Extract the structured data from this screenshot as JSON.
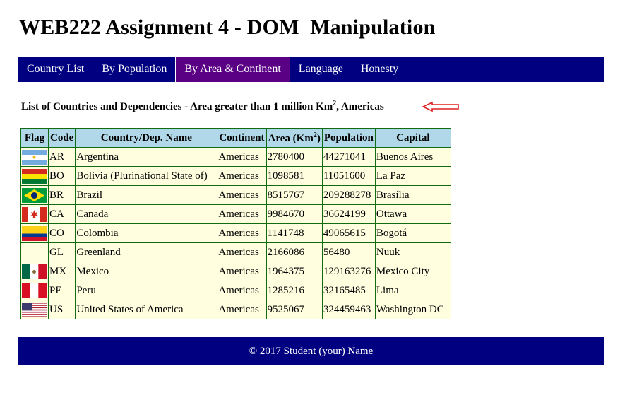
{
  "page": {
    "title": "WEB222 Assignment 4 - DOM  Manipulation"
  },
  "nav": {
    "items": [
      {
        "label": "Country List"
      },
      {
        "label": "By Population"
      },
      {
        "label": "By Area & Continent"
      },
      {
        "label": "Language"
      },
      {
        "label": "Honesty"
      }
    ],
    "active_index": 2,
    "bg_color": "#000080",
    "active_color": "#5a0084"
  },
  "subtitle": {
    "text": "List of Countries and Dependencies - Area greater than 1 million Km",
    "superscript": "2",
    "suffix": ", Americas"
  },
  "table": {
    "headers": {
      "flag": "Flag",
      "code": "Code",
      "name": "Country/Dep. Name",
      "continent": "Continent",
      "area": "Area (Km",
      "area_sup": "2",
      "area_close": ")",
      "population": "Population",
      "capital": "Capital"
    },
    "rows": [
      {
        "flag": "flag-argentina-icon",
        "code": "AR",
        "name": "Argentina",
        "continent": "Americas",
        "area": "2780400",
        "population": "44271041",
        "capital": "Buenos Aires"
      },
      {
        "flag": "flag-bolivia-icon",
        "code": "BO",
        "name": "Bolivia (Plurinational State of)",
        "continent": "Americas",
        "area": "1098581",
        "population": "11051600",
        "capital": "La Paz"
      },
      {
        "flag": "flag-brazil-icon",
        "code": "BR",
        "name": "Brazil",
        "continent": "Americas",
        "area": "8515767",
        "population": "209288278",
        "capital": "Brasília"
      },
      {
        "flag": "flag-canada-icon",
        "code": "CA",
        "name": "Canada",
        "continent": "Americas",
        "area": "9984670",
        "population": "36624199",
        "capital": "Ottawa"
      },
      {
        "flag": "flag-colombia-icon",
        "code": "CO",
        "name": "Colombia",
        "continent": "Americas",
        "area": "1141748",
        "population": "49065615",
        "capital": "Bogotá"
      },
      {
        "flag": "",
        "code": "GL",
        "name": "Greenland",
        "continent": "Americas",
        "area": "2166086",
        "population": "56480",
        "capital": "Nuuk"
      },
      {
        "flag": "flag-mexico-icon",
        "code": "MX",
        "name": "Mexico",
        "continent": "Americas",
        "area": "1964375",
        "population": "129163276",
        "capital": "Mexico City"
      },
      {
        "flag": "flag-peru-icon",
        "code": "PE",
        "name": "Peru",
        "continent": "Americas",
        "area": "1285216",
        "population": "32165485",
        "capital": "Lima"
      },
      {
        "flag": "flag-usa-icon",
        "code": "US",
        "name": "United States of America",
        "continent": "Americas",
        "area": "9525067",
        "population": "324459463",
        "capital": "Washington DC"
      }
    ],
    "header_bg": "#b0d8e8",
    "cell_bg": "#ffffe0",
    "border_color": "#116b11"
  },
  "footer": {
    "text": "© 2017 Student (your) Name"
  },
  "annotation": {
    "icon": "red-arrow-left-icon",
    "color": "#e02020"
  }
}
